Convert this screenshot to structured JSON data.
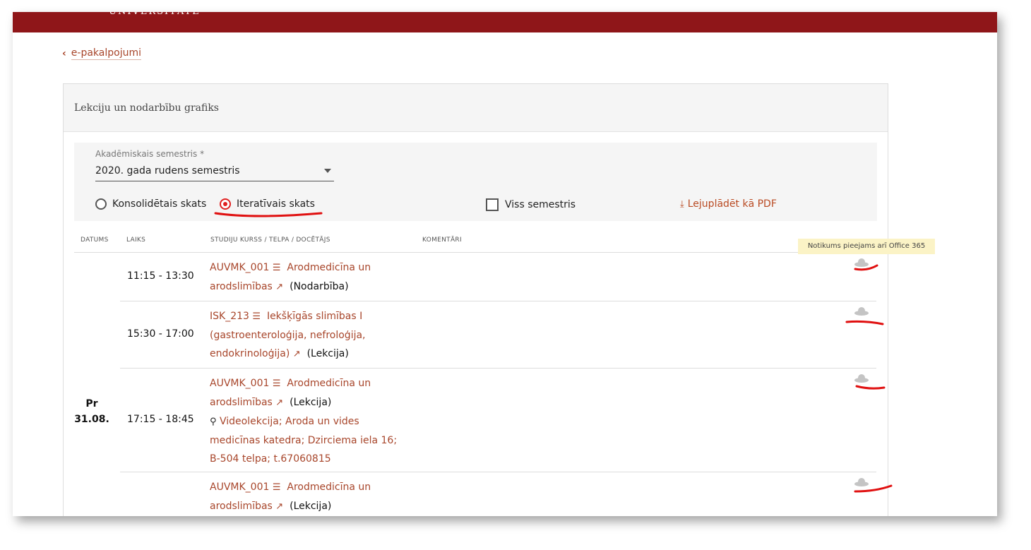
{
  "back_link": "e-pakalpojumi",
  "panel_title": "Lekciju un nodarbību grafiks",
  "semester": {
    "label": "Akadēmiskais semestris *",
    "value": "2020. gada rudens semestris"
  },
  "views": {
    "consolidated": "Konsolidētais skats",
    "iterative": "Iteratīvais skats",
    "whole_semester": "Viss semestris",
    "download_pdf": "Lejuplādēt kā PDF"
  },
  "table_headers": {
    "date": "DATUMS",
    "time": "LAIKS",
    "course": "STUDIJU KURSS / TELPA / DOCĒTĀJS",
    "comments": "KOMENTĀRI"
  },
  "tooltip": "Notikums pieejams arī Office 365",
  "day": {
    "weekday": "Pr",
    "date": "31.08."
  },
  "events": [
    {
      "time": "11:15 - 13:30",
      "code": "AUVMK_001",
      "name1": "Arodmedicīna un",
      "name2": "arodslimības",
      "type": "(Nodarbība)"
    },
    {
      "time": "15:30 - 17:00",
      "code": "ISK_213",
      "name1": "Iekšķīgās slimības I",
      "name2": "(gastroenteroloģija, nefroloģija,",
      "name3": "endokrinoloģija)",
      "type": "(Lekcija)"
    },
    {
      "time": "17:15 - 18:45",
      "code": "AUVMK_001",
      "name1": "Arodmedicīna un",
      "name2": "arodslimības",
      "type": "(Lekcija)",
      "location1": "Videolekcija; Aroda un vides",
      "location2": "medicīnas katedra; Dzirciema iela 16;",
      "location3": "B-504 telpa; t.67060815"
    },
    {
      "time": "",
      "code": "AUVMK_001",
      "name1": "Arodmedicīna un",
      "name2": "arodslimības",
      "type": "(Lekcija)"
    }
  ],
  "colors": {
    "brand": "#8f1619",
    "link": "#a8462b",
    "annotation": "#e01010"
  },
  "icons": [
    "chevron-left-icon",
    "list-icon",
    "external-link-icon",
    "map-pin-icon",
    "cloud-icon",
    "download-icon"
  ]
}
